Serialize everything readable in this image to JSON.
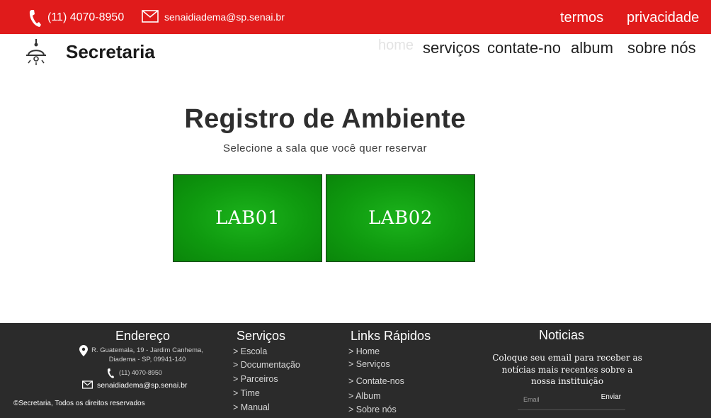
{
  "topbar": {
    "phone": "(11) 4070-8950",
    "email": "senaidiadema@sp.senai.br",
    "links": [
      "termos",
      "privacidade"
    ],
    "color": "#e01b1b"
  },
  "nav": {
    "brand": "Secretaria",
    "logo_icon": "lamp-icon",
    "items": [
      "home",
      "serviços",
      "contate-no",
      "album",
      "sobre nós"
    ]
  },
  "main": {
    "title": "Registro de Ambiente",
    "subtitle": "Selecione a sala que você quer reservar",
    "labs": [
      "LAB01",
      "LAB02"
    ],
    "lab_color": "#119f11"
  },
  "footer": {
    "address": {
      "heading": "Endereço",
      "line1": "R. Guatemala, 19 - Jardim Canhema,",
      "line2": "Diadema - SP, 09941-140",
      "phone": "(11) 4070-8950",
      "email": "senaidiadema@sp.senai.br"
    },
    "copyright": "©Secretaria, Todos os direitos reservados",
    "services": {
      "heading": "Serviços",
      "items": [
        "> Escola",
        "> Documentação",
        "> Parceiros",
        "> Time",
        "> Manual"
      ]
    },
    "quick_links": {
      "heading": "Links Rápidos",
      "items": [
        "> Home",
        "> Serviços",
        "> Contate-nos",
        "> Album",
        "> Sobre nós"
      ]
    },
    "news": {
      "heading": "Noticias",
      "text": "Coloque seu email para receber as notícias mais recentes sobre a nossa instituição",
      "placeholder": "Email",
      "button": "Enviar"
    },
    "background": "#2b2b2b"
  }
}
